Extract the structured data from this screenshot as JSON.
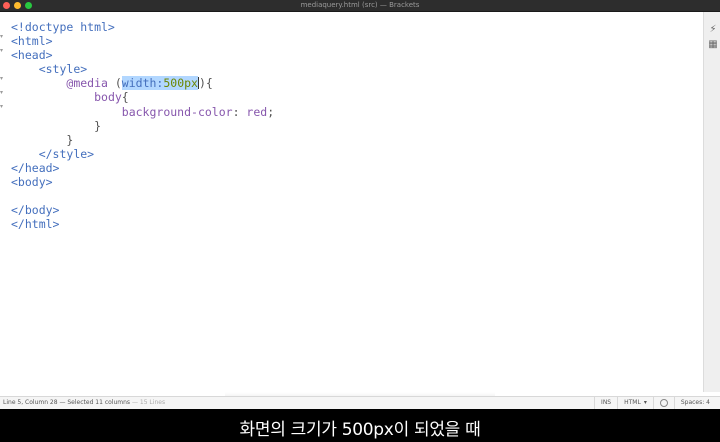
{
  "window": {
    "title": "mediaquery.html (src) — Brackets"
  },
  "editor": {
    "lines": [
      {
        "parts": [
          {
            "t": "<!doctype html>",
            "c": "tag"
          }
        ]
      },
      {
        "parts": [
          {
            "t": "<html>",
            "c": "tag"
          }
        ]
      },
      {
        "parts": [
          {
            "t": "<head>",
            "c": "tag"
          }
        ]
      },
      {
        "parts": [
          {
            "t": "    ",
            "c": "punct"
          },
          {
            "t": "<style>",
            "c": "tag"
          }
        ]
      },
      {
        "parts": [
          {
            "t": "        ",
            "c": "punct"
          },
          {
            "t": "@media",
            "c": "kw"
          },
          {
            "t": " (",
            "c": "punct"
          },
          {
            "t": "width:",
            "c": "sel-prop sel"
          },
          {
            "t": "500px",
            "c": "sel-num sel"
          },
          {
            "t": "){",
            "c": "punct"
          }
        ]
      },
      {
        "parts": [
          {
            "t": "            ",
            "c": "punct"
          },
          {
            "t": "body",
            "c": "kw"
          },
          {
            "t": "{",
            "c": "punct"
          }
        ]
      },
      {
        "parts": [
          {
            "t": "                ",
            "c": "punct"
          },
          {
            "t": "background-color",
            "c": "kw"
          },
          {
            "t": ": ",
            "c": "punct"
          },
          {
            "t": "red",
            "c": "kw"
          },
          {
            "t": ";",
            "c": "punct"
          }
        ]
      },
      {
        "parts": [
          {
            "t": "            }",
            "c": "punct"
          }
        ]
      },
      {
        "parts": [
          {
            "t": "        }",
            "c": "punct"
          }
        ]
      },
      {
        "parts": [
          {
            "t": "    ",
            "c": "punct"
          },
          {
            "t": "</style>",
            "c": "tag"
          }
        ]
      },
      {
        "parts": [
          {
            "t": "</head>",
            "c": "tag"
          }
        ]
      },
      {
        "parts": [
          {
            "t": "<body>",
            "c": "tag"
          }
        ]
      },
      {
        "parts": [
          {
            "t": "",
            "c": "punct"
          }
        ]
      },
      {
        "parts": [
          {
            "t": "</body>",
            "c": "tag"
          }
        ]
      },
      {
        "parts": [
          {
            "t": "</html>",
            "c": "tag"
          }
        ]
      }
    ]
  },
  "statusbar": {
    "cursor_info": "Line 5, Column 28 — Selected 11 columns",
    "line_count": "— 15 Lines",
    "insert_mode": "INS",
    "language": "HTML",
    "spaces": "Spaces: 4"
  },
  "rightbar": {
    "icons": [
      "live-preview-icon",
      "extension-manager-icon"
    ]
  },
  "subtitle": {
    "text": "화면의 크기가 500px이 되었을 때"
  },
  "colors": {
    "tag": "#446fbd",
    "keyword": "#8757ad",
    "number": "#6d8600",
    "selection": "#b2d7ff"
  }
}
